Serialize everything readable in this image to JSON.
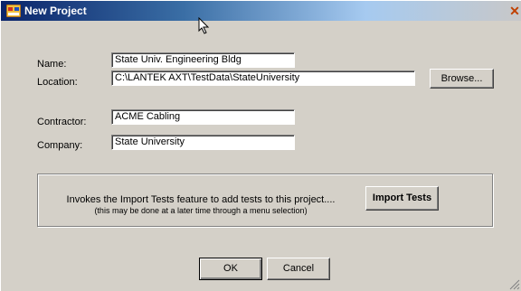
{
  "window": {
    "title": "New Project",
    "close_glyph": "✕"
  },
  "form": {
    "name_label": "Name:",
    "name_value": "State Univ. Engineering Bldg",
    "location_label": "Location:",
    "location_value": "C:\\LANTEK AXT\\TestData\\StateUniversity",
    "browse_label": "Browse...",
    "contractor_label": "Contractor:",
    "contractor_value": "ACME Cabling",
    "company_label": "Company:",
    "company_value": "State University"
  },
  "import": {
    "description": "Invokes the Import Tests feature to add tests to this project....",
    "hint": "(this may be done at a later time through a menu selection)",
    "button_label": "Import Tests"
  },
  "actions": {
    "ok_label": "OK",
    "cancel_label": "Cancel"
  },
  "icons": {
    "app": "app-window-icon",
    "cursor": "mouse-cursor-icon",
    "grip": "resize-grip-icon"
  }
}
